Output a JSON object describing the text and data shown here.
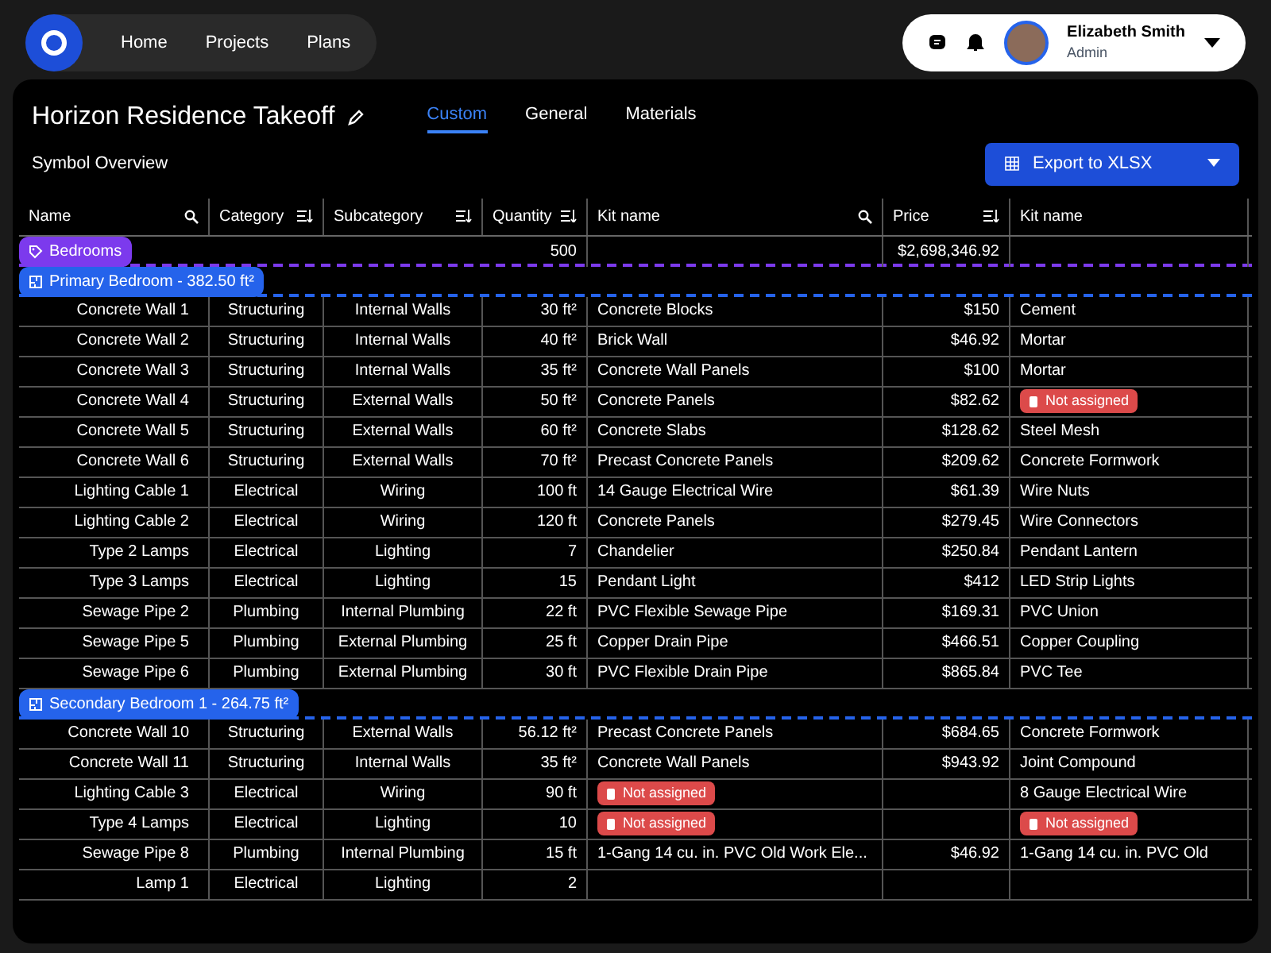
{
  "nav": {
    "items": [
      {
        "label": "Home"
      },
      {
        "label": "Projects"
      },
      {
        "label": "Plans"
      }
    ]
  },
  "user": {
    "name": "Elizabeth Smith",
    "role": "Admin"
  },
  "page": {
    "title": "Horizon Residence Takeoff",
    "tabs": [
      {
        "label": "Custom",
        "selected": true
      },
      {
        "label": "General",
        "selected": false
      },
      {
        "label": "Materials",
        "selected": false
      }
    ],
    "section": "Symbol Overview",
    "export_button": "Export to XLSX"
  },
  "table": {
    "columns": [
      {
        "label": "Name",
        "kind": "search"
      },
      {
        "label": "Category",
        "kind": "sort"
      },
      {
        "label": "Subcategory",
        "kind": "sort"
      },
      {
        "label": "Quantity",
        "kind": "sort"
      },
      {
        "label": "Kit name",
        "kind": "search"
      },
      {
        "label": "Price",
        "kind": "sort"
      },
      {
        "label": "Kit name",
        "kind": "plain"
      }
    ],
    "groups": [
      {
        "label": "Bedrooms",
        "kind": "category",
        "color": "#7c3aed",
        "quantity": "500",
        "price": "$2,698,346.92"
      },
      {
        "label": "Primary Bedroom - 382.50 ft²",
        "kind": "room",
        "color": "#2563eb",
        "rows": [
          {
            "name": "Concrete Wall 1",
            "category": "Structuring",
            "subcategory": "Internal Walls",
            "quantity": "30 ft²",
            "kit": {
              "kind": "text",
              "text": "Concrete Blocks"
            },
            "price": "$150",
            "kit_2": {
              "kind": "text",
              "text": "Cement"
            }
          },
          {
            "name": "Concrete Wall 2",
            "category": "Structuring",
            "subcategory": "Internal Walls",
            "quantity": "40 ft²",
            "kit": {
              "kind": "text",
              "text": "Brick Wall"
            },
            "price": "$46.92",
            "kit_2": {
              "kind": "text",
              "text": "Mortar"
            }
          },
          {
            "name": "Concrete Wall 3",
            "category": "Structuring",
            "subcategory": "Internal Walls",
            "quantity": "35 ft²",
            "kit": {
              "kind": "text",
              "text": "Concrete Wall Panels"
            },
            "price": "$100",
            "kit_2": {
              "kind": "text",
              "text": "Mortar"
            }
          },
          {
            "name": "Concrete Wall 4",
            "category": "Structuring",
            "subcategory": "External Walls",
            "quantity": "50 ft²",
            "kit": {
              "kind": "text",
              "text": "Concrete Panels"
            },
            "price": "$82.62",
            "kit_2": {
              "kind": "unassigned",
              "text": "Not assigned"
            }
          },
          {
            "name": "Concrete Wall 5",
            "category": "Structuring",
            "subcategory": "External Walls",
            "quantity": "60 ft²",
            "kit": {
              "kind": "text",
              "text": "Concrete Slabs"
            },
            "price": "$128.62",
            "kit_2": {
              "kind": "text",
              "text": "Steel Mesh"
            }
          },
          {
            "name": "Concrete Wall 6",
            "category": "Structuring",
            "subcategory": "External Walls",
            "quantity": "70 ft²",
            "kit": {
              "kind": "text",
              "text": "Precast Concrete Panels"
            },
            "price": "$209.62",
            "kit_2": {
              "kind": "text",
              "text": "Concrete Formwork"
            }
          },
          {
            "name": "Lighting Cable 1",
            "category": "Electrical",
            "subcategory": "Wiring",
            "quantity": "100 ft",
            "kit": {
              "kind": "text",
              "text": "14 Gauge Electrical Wire"
            },
            "price": "$61.39",
            "kit_2": {
              "kind": "text",
              "text": "Wire Nuts"
            }
          },
          {
            "name": "Lighting Cable 2",
            "category": "Electrical",
            "subcategory": "Wiring",
            "quantity": "120 ft",
            "kit": {
              "kind": "text",
              "text": "Concrete Panels"
            },
            "price": "$279.45",
            "kit_2": {
              "kind": "text",
              "text": "Wire Connectors"
            }
          },
          {
            "name": "Type 2 Lamps",
            "category": "Electrical",
            "subcategory": "Lighting",
            "quantity": "7",
            "kit": {
              "kind": "text",
              "text": "Chandelier"
            },
            "price": "$250.84",
            "kit_2": {
              "kind": "text",
              "text": "Pendant Lantern"
            }
          },
          {
            "name": "Type 3 Lamps",
            "category": "Electrical",
            "subcategory": "Lighting",
            "quantity": "15",
            "kit": {
              "kind": "text",
              "text": "Pendant Light"
            },
            "price": "$412",
            "kit_2": {
              "kind": "text",
              "text": "LED Strip Lights"
            }
          },
          {
            "name": "Sewage Pipe 2",
            "category": "Plumbing",
            "subcategory": "Internal Plumbing",
            "quantity": "22 ft",
            "kit": {
              "kind": "text",
              "text": "PVC Flexible Sewage Pipe"
            },
            "price": "$169.31",
            "kit_2": {
              "kind": "text",
              "text": "PVC Union"
            }
          },
          {
            "name": "Sewage Pipe 5",
            "category": "Plumbing",
            "subcategory": "External Plumbing",
            "quantity": "25 ft",
            "kit": {
              "kind": "text",
              "text": "Copper Drain Pipe"
            },
            "price": "$466.51",
            "kit_2": {
              "kind": "text",
              "text": "Copper Coupling"
            }
          },
          {
            "name": "Sewage Pipe 6",
            "category": "Plumbing",
            "subcategory": "External Plumbing",
            "quantity": "30 ft",
            "kit": {
              "kind": "text",
              "text": "PVC Flexible Drain Pipe"
            },
            "price": "$865.84",
            "kit_2": {
              "kind": "text",
              "text": "PVC Tee"
            }
          }
        ]
      },
      {
        "label": "Secondary Bedroom 1 - 264.75 ft²",
        "kind": "room",
        "color": "#2563eb",
        "rows": [
          {
            "name": "Concrete Wall 10",
            "category": "Structuring",
            "subcategory": "External Walls",
            "quantity": "56.12 ft²",
            "kit": {
              "kind": "text",
              "text": "Precast Concrete Panels"
            },
            "price": "$684.65",
            "kit_2": {
              "kind": "text",
              "text": "Concrete Formwork"
            }
          },
          {
            "name": "Concrete Wall 11",
            "category": "Structuring",
            "subcategory": "Internal Walls",
            "quantity": "35 ft²",
            "kit": {
              "kind": "text",
              "text": "Concrete Wall Panels"
            },
            "price": "$943.92",
            "kit_2": {
              "kind": "text",
              "text": "Joint Compound"
            }
          },
          {
            "name": "Lighting Cable 3",
            "category": "Electrical",
            "subcategory": "Wiring",
            "quantity": "90 ft",
            "kit": {
              "kind": "unassigned",
              "text": "Not assigned"
            },
            "kit_2": {
              "kind": "text",
              "text": "8 Gauge Electrical Wire"
            }
          },
          {
            "name": "Type 4 Lamps",
            "category": "Electrical",
            "subcategory": "Lighting",
            "quantity": "10",
            "kit": {
              "kind": "unassigned",
              "text": "Not assigned"
            },
            "kit_2": {
              "kind": "unassigned",
              "text": "Not assigned"
            }
          },
          {
            "name": "Sewage Pipe 8",
            "category": "Plumbing",
            "subcategory": "Internal Plumbing",
            "quantity": "15 ft",
            "kit": {
              "kind": "text",
              "text": "1-Gang 14 cu. in. PVC Old Work Ele..."
            },
            "price": "$46.92",
            "kit_2": {
              "kind": "text",
              "text": "1-Gang 14 cu. in. PVC Old"
            }
          },
          {
            "name": "Lamp 1",
            "category": "Electrical",
            "subcategory": "Lighting",
            "quantity": "2"
          }
        ]
      }
    ]
  }
}
